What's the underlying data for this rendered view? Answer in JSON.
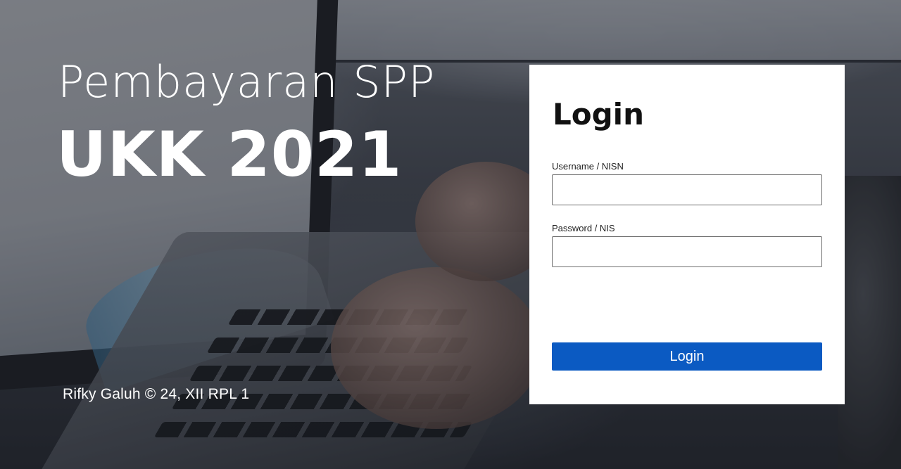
{
  "hero": {
    "title": "Pembayaran SPP",
    "subtitle": "UKK 2021"
  },
  "footer": {
    "credit": "Rifky Galuh © 24, XII RPL 1"
  },
  "login": {
    "heading": "Login",
    "username_label": "Username / NISN",
    "username_value": "",
    "password_label": "Password / NIS",
    "password_value": "",
    "submit_label": "Login"
  },
  "colors": {
    "primary_button": "#0b5ac2",
    "card_background": "#ffffff",
    "hero_text": "#ffffff"
  }
}
